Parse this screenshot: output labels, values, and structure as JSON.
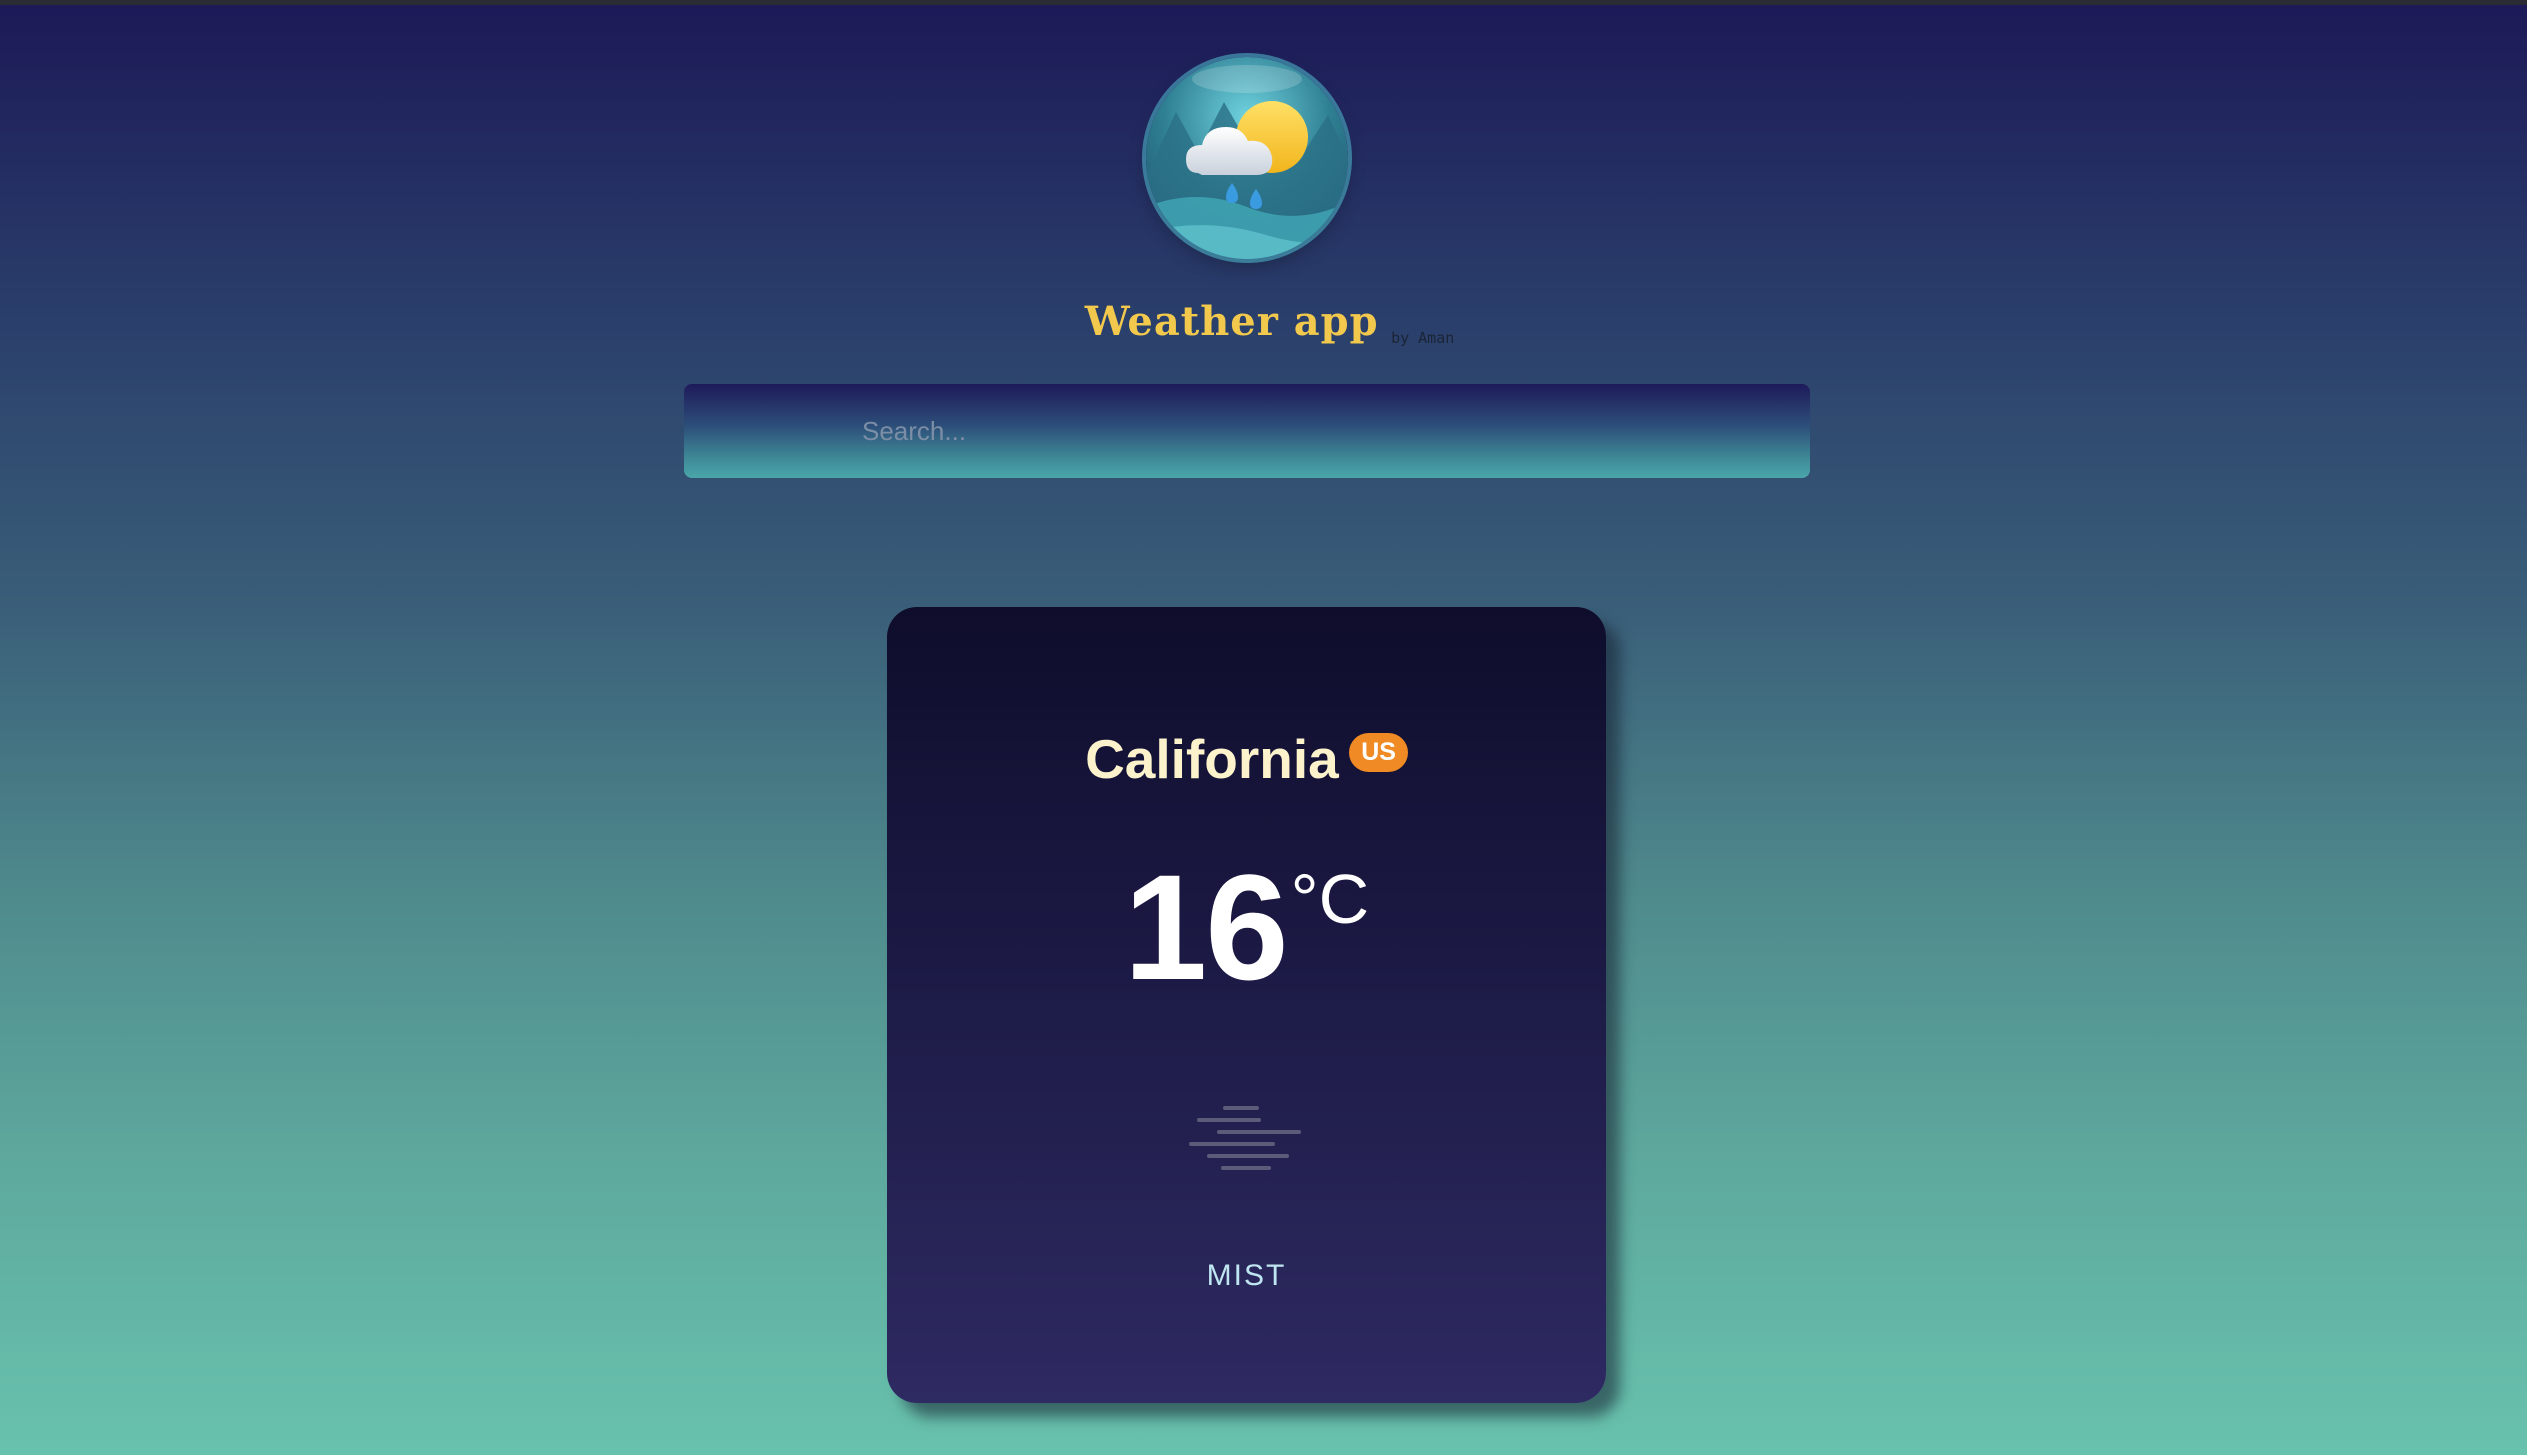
{
  "header": {
    "logo_icon": "weather-cloud-sun-rain-icon",
    "title": "Weather app",
    "byline": "by Aman"
  },
  "search": {
    "placeholder": "Search...",
    "value": ""
  },
  "weather_card": {
    "city": "California",
    "country": "US",
    "temperature": "16",
    "unit": "°C",
    "condition_icon": "mist-icon",
    "condition": "MIST"
  },
  "colors": {
    "title": "#f2c94c",
    "badge": "#f08a24",
    "city": "#fcf2cc",
    "condition": "#bfe6f0",
    "card_top": "#0f0d2b",
    "card_bottom": "#2e2a62"
  }
}
